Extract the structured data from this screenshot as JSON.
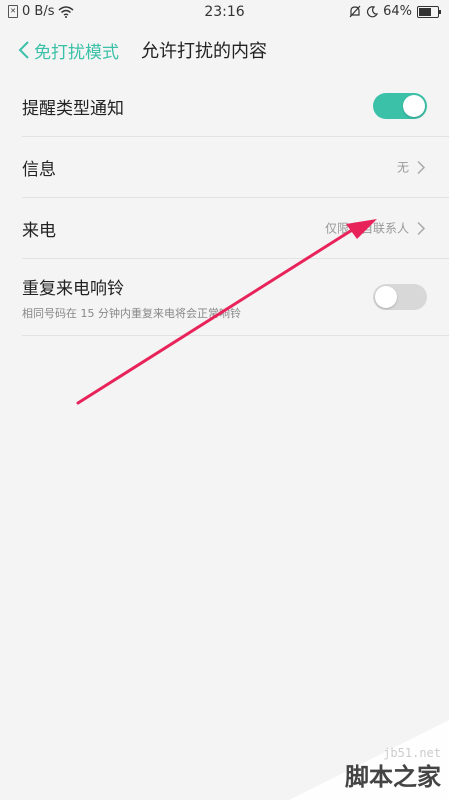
{
  "status_bar": {
    "network_speed": "0 B/s",
    "time": "23:16",
    "battery": "64%",
    "battery_level": 0.64,
    "icons": [
      "sim-icon",
      "wifi-icon",
      "bell-mute-icon",
      "moon-icon",
      "battery-icon"
    ]
  },
  "header": {
    "back_label": "免打扰模式",
    "title": "允许打扰的内容"
  },
  "rows": [
    {
      "label": "提醒类型通知",
      "toggle": "on"
    },
    {
      "label": "信息",
      "value": "无"
    },
    {
      "label": "来电",
      "value": "仅限来自联系人"
    },
    {
      "label": "重复来电响铃",
      "subtitle": "相同号码在 15 分钟内重复来电将会正常响铃",
      "toggle": "off"
    }
  ],
  "colors": {
    "accent": "#3cc1a9",
    "arrow": "#e8235a",
    "background": "#f4f4f4"
  },
  "watermark": {
    "url": "jb51.net",
    "brand": "脚本之家"
  }
}
